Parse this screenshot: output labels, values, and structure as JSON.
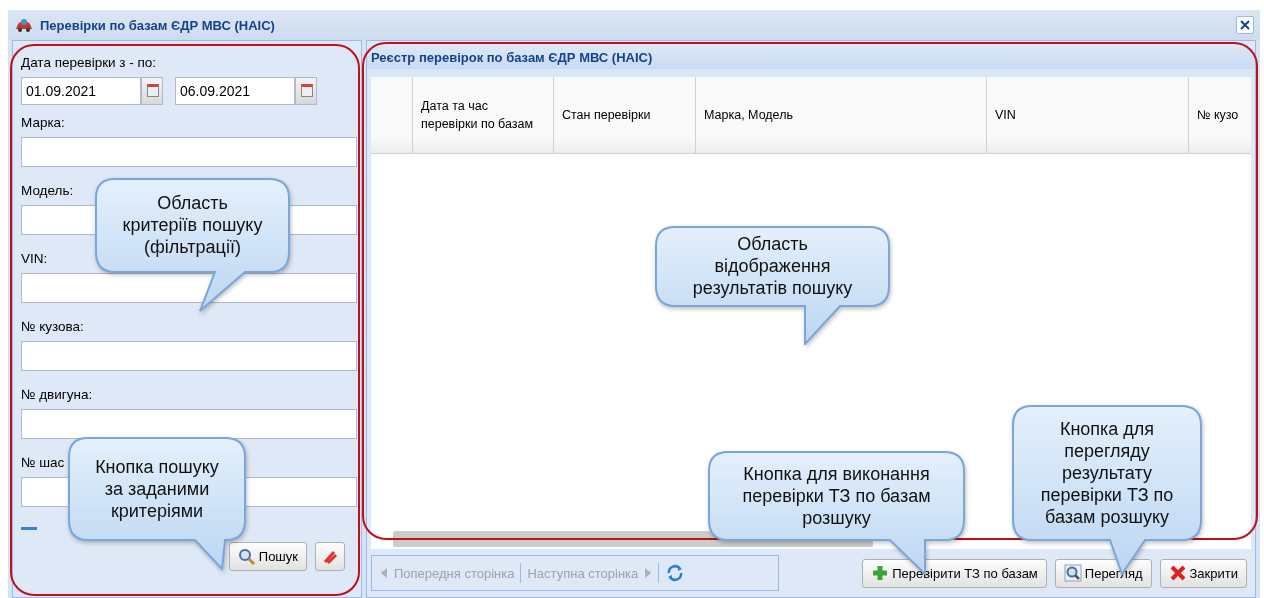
{
  "window": {
    "title": "Перевірки по базам ЄДР МВС (НАІС)"
  },
  "filters": {
    "date_label": "Дата перевірки з - по:",
    "date_from": "01.09.2021",
    "date_to": "06.09.2021",
    "fields": [
      {
        "label": "Марка:"
      },
      {
        "label": "Модель:"
      },
      {
        "label": "VIN:"
      },
      {
        "label": "№ кузова:"
      },
      {
        "label": "№ двигуна:"
      },
      {
        "label": "№ шас"
      }
    ],
    "search_button": "Пошук"
  },
  "grid": {
    "title": "Реєстр перевірок по базам ЄДР МВС (НАІС)",
    "columns": [
      "Дата та час перевірки по базам",
      "Стан перевірки",
      "Марка, Модель",
      "VIN",
      "№ кузо"
    ]
  },
  "pager": {
    "previous": {
      "label": "Попередня сторінка",
      "disabled": true
    },
    "next": {
      "label": "Наступна сторінка",
      "disabled": true
    }
  },
  "buttons": [
    {
      "kind": "add",
      "label": "Перевірити ТЗ по базам"
    },
    {
      "kind": "view",
      "label": "Перегляд"
    },
    {
      "kind": "close",
      "label": "Закрити"
    }
  ],
  "callouts": [
    "Область критеріїв пошуку (фільтрації)",
    "Область відображення результатів пошуку",
    "Кнопка пошуку за заданими критеріями",
    "Кнопка для виконання перевірки ТЗ по базам розшуку",
    "Кнопка для перегляду результату перевірки ТЗ по базам розшуку"
  ]
}
